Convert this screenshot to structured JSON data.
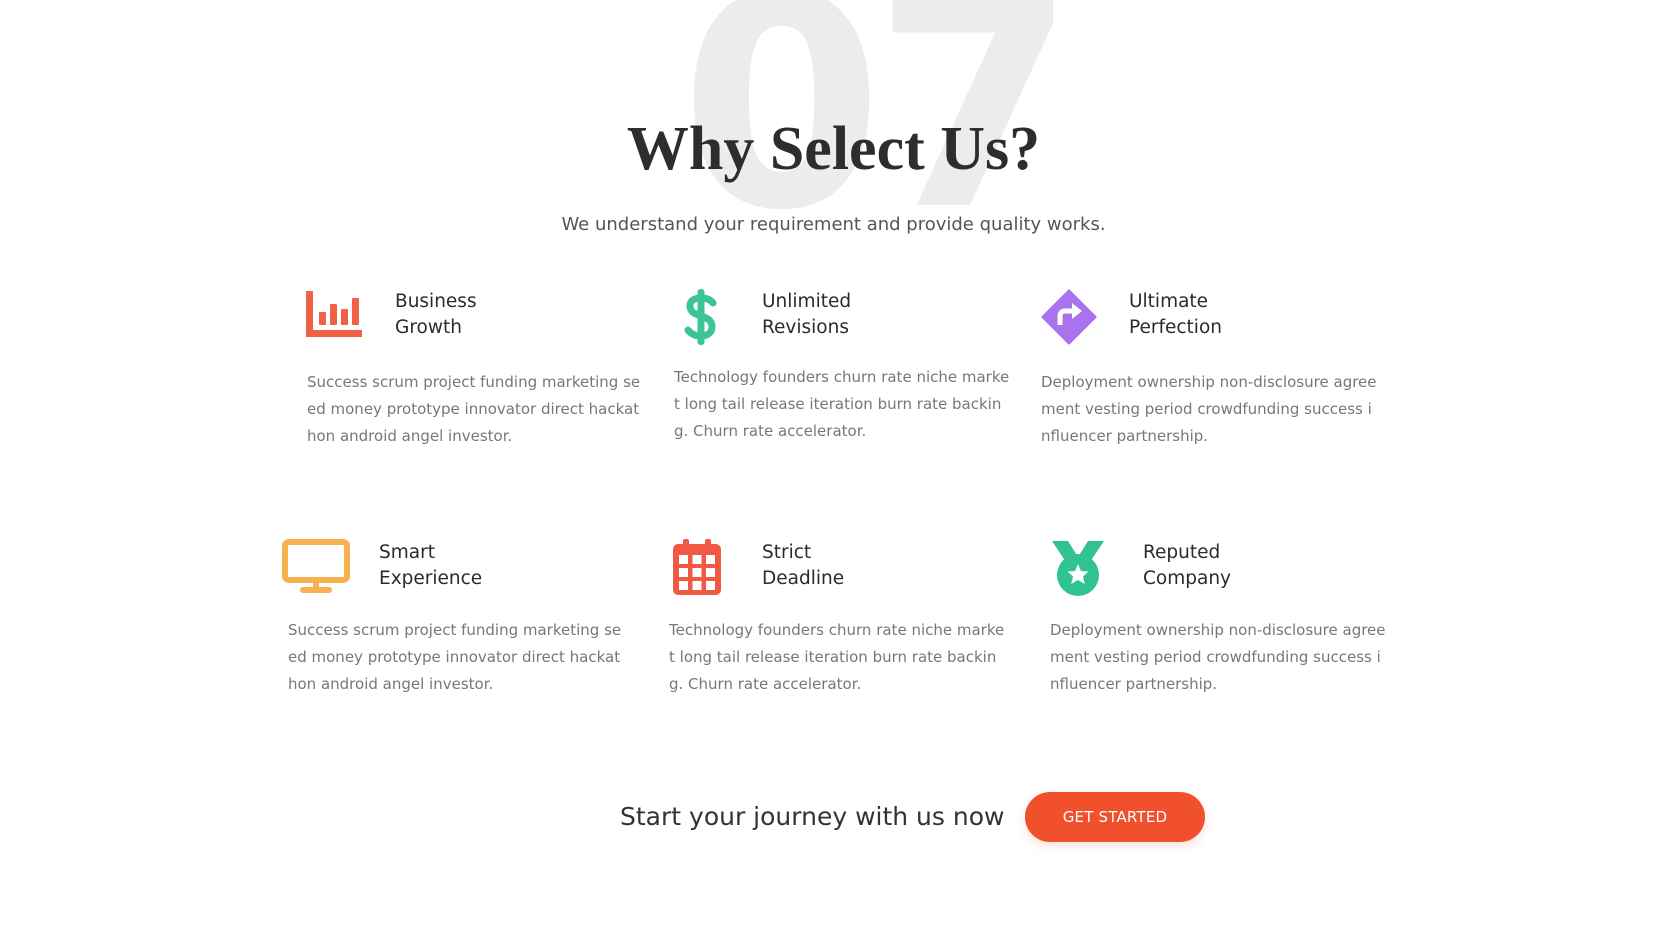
{
  "background_number": "07",
  "header": {
    "title": "Why Select Us?",
    "subtitle": "We understand your requirement and provide quality works."
  },
  "features": [
    {
      "title": "Business\nGrowth",
      "text": "Success scrum project funding marketing seed money prototype innovator direct hackathon android angel investor.",
      "icon": "bar-chart-icon",
      "color": "#f16244"
    },
    {
      "title": "Unlimited\nRevisions",
      "text": "Technology founders churn rate niche market long tail release iteration burn rate backing. Churn rate accelerator.",
      "icon": "dollar-icon",
      "color": "#3cc494"
    },
    {
      "title": "Ultimate\nPerfection",
      "text": "Deployment ownership non-disclosure agreement vesting period crowdfunding success influencer partnership.",
      "icon": "direction-sign-icon",
      "color": "#a973ee"
    },
    {
      "title": "Smart\nExperience",
      "text": "Success scrum project funding marketing seed money prototype innovator direct hackathon android angel investor.",
      "icon": "monitor-icon",
      "color": "#f8b14f"
    },
    {
      "title": "Strict\nDeadline",
      "text": "Technology founders churn rate niche market long tail release iteration burn rate backing. Churn rate accelerator.",
      "icon": "calendar-icon",
      "color": "#f05a44"
    },
    {
      "title": "Reputed\nCompany",
      "text": "Deployment ownership non-disclosure agreement vesting period crowdfunding success influencer partnership.",
      "icon": "medal-icon",
      "color": "#30c391"
    }
  ],
  "cta": {
    "text": "Start your journey with us now",
    "button_label": "GET STARTED",
    "button_color": "#f0502c"
  }
}
